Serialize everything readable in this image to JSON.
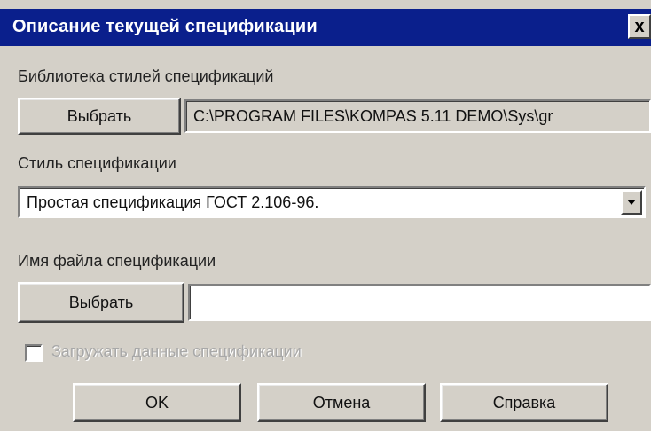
{
  "window": {
    "title": "Описание текущей спецификации",
    "close_glyph": "x"
  },
  "library": {
    "label": "Библиотека стилей спецификаций",
    "button_label": "Выбрать",
    "path": "C:\\PROGRAM FILES\\KOMPAS 5.11 DEMO\\Sys\\gr"
  },
  "style": {
    "label": "Стиль спецификации",
    "selected": "Простая спецификация ГОСТ 2.106-96."
  },
  "file": {
    "label": "Имя файла спецификации",
    "button_label": "Выбрать",
    "value": ""
  },
  "option": {
    "label": "Загружать данные спецификации",
    "checked": false,
    "enabled": false
  },
  "buttons": {
    "ok": "OK",
    "cancel": "Отмена",
    "help": "Справка"
  }
}
